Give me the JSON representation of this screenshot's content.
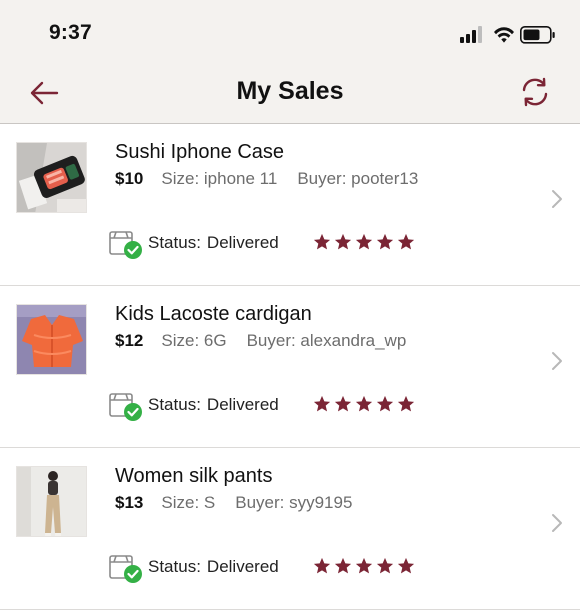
{
  "status_bar": {
    "time": "9:37"
  },
  "header": {
    "title": "My Sales"
  },
  "colors": {
    "accent": "#7b2535",
    "status_green": "#34b046",
    "bar_bg": "#f4f2ef"
  },
  "sales": [
    {
      "title": "Sushi Iphone Case",
      "price": "$10",
      "size": "Size: iphone 11",
      "buyer": "Buyer: pooter13",
      "status_label": "Status:",
      "status_value": "Delivered",
      "rating": 5,
      "thumbnail": "photo of a sushi-themed phone case"
    },
    {
      "title": "Kids Lacoste cardigan",
      "price": "$12",
      "size": "Size: 6G",
      "buyer": "Buyer: alexandra_wp",
      "status_label": "Status:",
      "status_value": "Delivered",
      "rating": 5,
      "thumbnail": "photo of an orange knitted cardigan"
    },
    {
      "title": "Women silk pants",
      "price": "$13",
      "size": "Size: S",
      "buyer": "Buyer: syy9195",
      "status_label": "Status:",
      "status_value": "Delivered",
      "rating": 5,
      "thumbnail": "photo of a woman wearing beige silk pants"
    }
  ]
}
